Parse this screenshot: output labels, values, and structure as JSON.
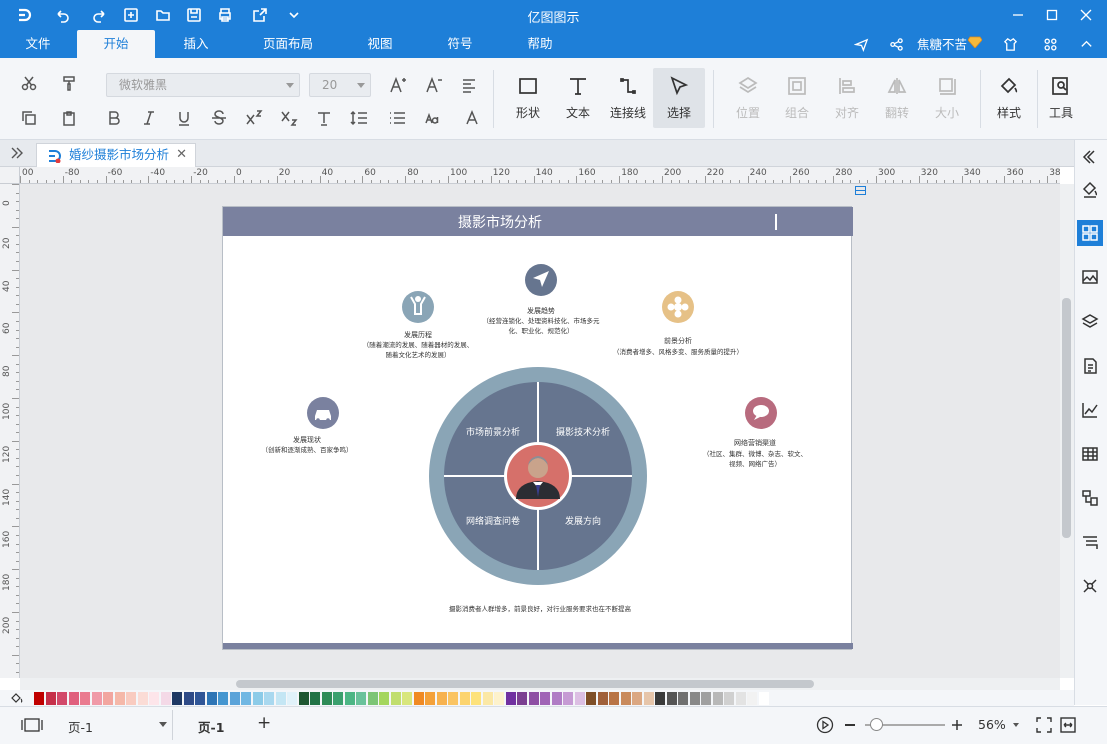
{
  "app": {
    "title": "亿图图示",
    "user": "焦糖不苦"
  },
  "menu": {
    "items": [
      "文件",
      "开始",
      "插入",
      "页面布局",
      "视图",
      "符号",
      "帮助"
    ],
    "active": "开始"
  },
  "ribbon": {
    "font_family": "微软雅黑",
    "font_size": "20",
    "tools": {
      "shape": "形状",
      "text": "文本",
      "connector": "连接线",
      "select": "选择"
    },
    "arrange": {
      "position": "位置",
      "group": "组合",
      "align": "对齐",
      "rotate": "翻转",
      "size": "大小"
    },
    "style": "样式",
    "tools_menu": "工具"
  },
  "tab": {
    "doc_name": "婚纱摄影市场分析"
  },
  "ruler": {
    "h": [
      "00",
      "-80",
      "-60",
      "-40",
      "-20",
      "0",
      "20",
      "40",
      "60",
      "80",
      "100",
      "120",
      "140",
      "160",
      "180",
      "200",
      "220",
      "240",
      "260",
      "280",
      "300",
      "320",
      "340",
      "360",
      "380"
    ],
    "v": [
      "0",
      "20",
      "40",
      "60",
      "80",
      "100",
      "120",
      "140",
      "160",
      "180",
      "200"
    ]
  },
  "diagram": {
    "title": "摄影市场分析",
    "quadrants": [
      "市场前景分析",
      "摄影技术分析",
      "网络调查问卷",
      "发展方向"
    ],
    "nodes": [
      {
        "title": "发展趋势",
        "desc1": "（经营连锁化、处理资料技化、市场多元",
        "desc2": "化、职业化、规范化）"
      },
      {
        "title": "发展历程",
        "desc1": "（随着潮流的发展、随着器材的发展、",
        "desc2": "随着文化艺术的发展）"
      },
      {
        "title": "前景分析",
        "desc1": "（消费者增多、风格多变、服务质量的提升）",
        "desc2": ""
      },
      {
        "title": "发展现状",
        "desc1": "（创新和逐渐成熟、百家争鸣）",
        "desc2": ""
      },
      {
        "title": "网络营销渠道",
        "desc1": "（社区、集群、微博、杂志、软文、",
        "desc2": "视频、网络广告）"
      }
    ],
    "footer": "摄影消费者人群增多，前景良好，对行业服务要求也在不断提高",
    "colors": {
      "header": "#7a819f",
      "ring": "#8aa5b6",
      "quadrant": "#66758f",
      "center": "#d6706a"
    }
  },
  "status": {
    "page_selector": "页-1",
    "page_tab": "页-1",
    "add": "+",
    "zoom": "56%"
  }
}
